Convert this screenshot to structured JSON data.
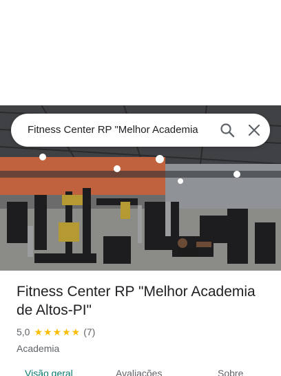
{
  "search": {
    "value": "Fitness Center RP \"Melhor Academia de Altos-PI\""
  },
  "place": {
    "title": "Fitness Center RP \"Melhor Academia de Altos-PI\"",
    "rating": "5,0",
    "stars": "★★★★★",
    "review_count": "(7)",
    "category": "Academia"
  },
  "tabs": [
    {
      "label": "Visão geral",
      "active": true
    },
    {
      "label": "Avaliações",
      "active": false
    },
    {
      "label": "Sobre",
      "active": false
    }
  ],
  "colors": {
    "star": "#fbbc04",
    "active_tab": "#0b7a6f"
  }
}
